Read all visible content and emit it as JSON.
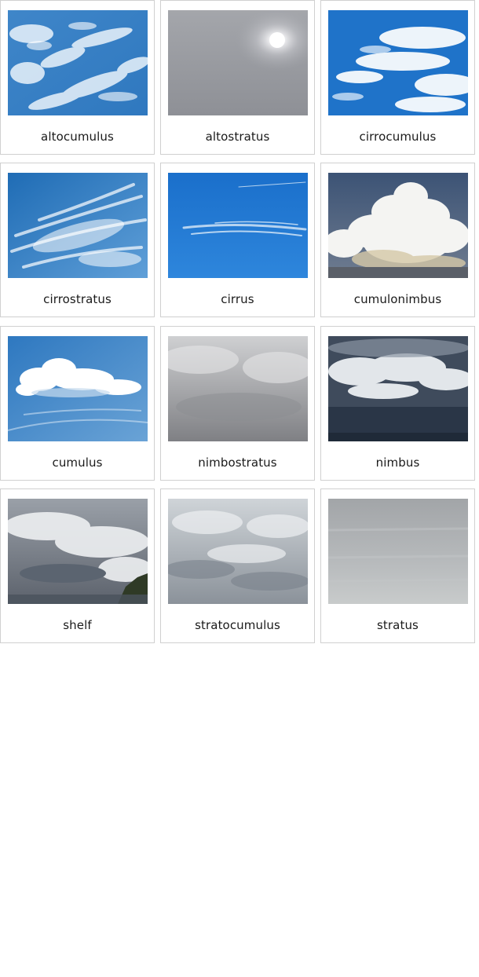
{
  "cards": [
    {
      "label": "altocumulus",
      "image": "altocumulus-photo"
    },
    {
      "label": "altostratus",
      "image": "altostratus-photo"
    },
    {
      "label": "cirrocumulus",
      "image": "cirrocumulus-photo"
    },
    {
      "label": "cirrostratus",
      "image": "cirrostratus-photo"
    },
    {
      "label": "cirrus",
      "image": "cirrus-photo"
    },
    {
      "label": "cumulonimbus",
      "image": "cumulonimbus-photo"
    },
    {
      "label": "cumulus",
      "image": "cumulus-photo"
    },
    {
      "label": "nimbostratus",
      "image": "nimbostratus-photo"
    },
    {
      "label": "nimbus",
      "image": "nimbus-photo"
    },
    {
      "label": "shelf",
      "image": "shelf-photo"
    },
    {
      "label": "stratocumulus",
      "image": "stratocumulus-photo"
    },
    {
      "label": "stratus",
      "image": "stratus-photo"
    }
  ]
}
